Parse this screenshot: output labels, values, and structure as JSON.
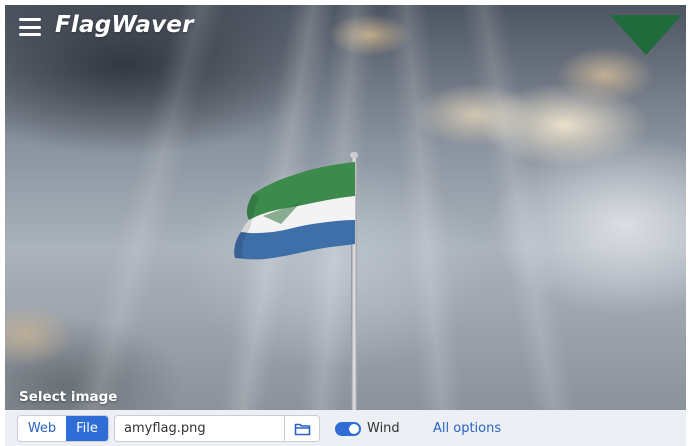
{
  "header": {
    "title": "FlagWaver",
    "menu_icon": "hamburger-menu-icon",
    "corner_icon": "triangle-down-icon",
    "corner_color": "#1f6b3b"
  },
  "scene": {
    "flag_colors": {
      "green": "#3c8a4c",
      "white": "#f3f3f3",
      "blue": "#3f6fa8"
    }
  },
  "image_source": {
    "section_label": "Select image",
    "tabs": [
      {
        "label": "Web",
        "selected": false
      },
      {
        "label": "File",
        "selected": true
      }
    ],
    "file_name": "amyflag.png",
    "browse_icon": "folder-icon"
  },
  "controls": {
    "wind": {
      "label": "Wind",
      "enabled": true
    },
    "all_options_label": "All options"
  },
  "colors": {
    "accent": "#2f6cd6",
    "link": "#2a63c4",
    "toolbar_bg": "#eceff4"
  }
}
